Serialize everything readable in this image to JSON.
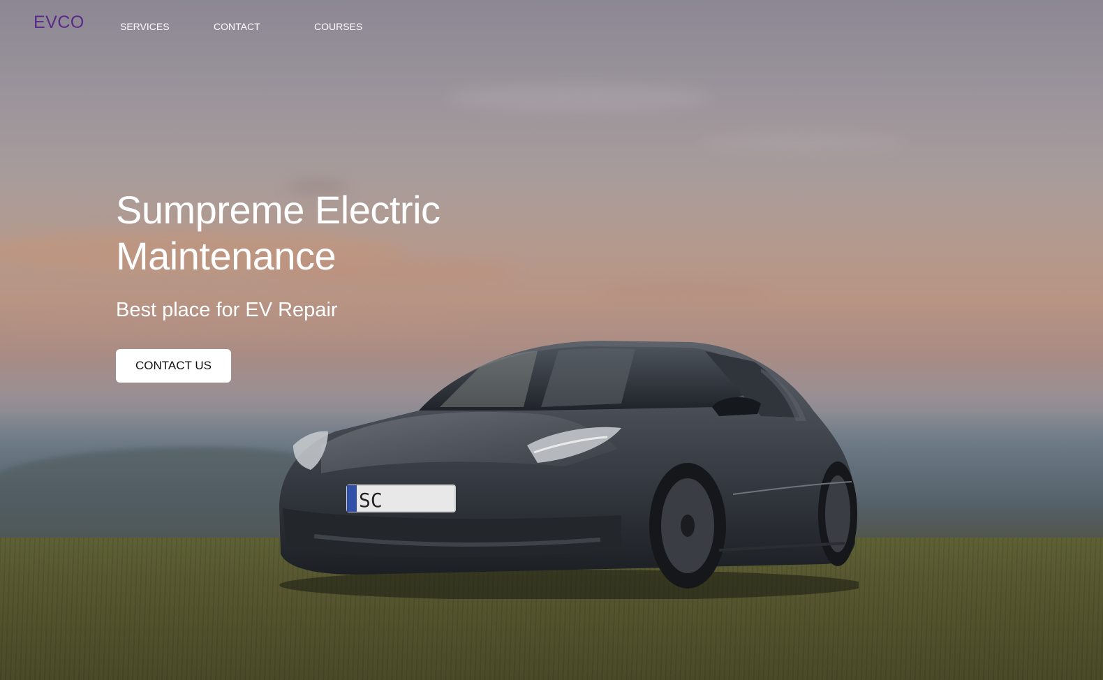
{
  "brand": {
    "logo": "EVCO",
    "logo_color": "#5a2a86"
  },
  "nav": {
    "items": [
      {
        "label": "SERVICES"
      },
      {
        "label": "CONTACT"
      },
      {
        "label": "COURSES"
      }
    ]
  },
  "hero": {
    "headline": "Sumpreme Electric Maintenance",
    "subhead": "Best place for EV Repair",
    "cta_label": "CONTACT US"
  },
  "background": {
    "icon": "ev-car-hero-photo",
    "license_plate": "SC"
  }
}
